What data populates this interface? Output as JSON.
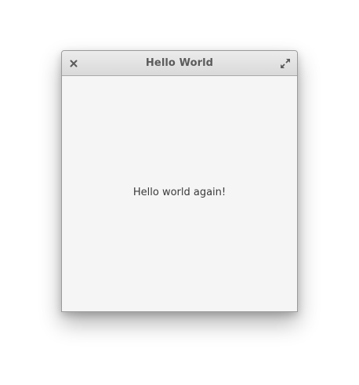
{
  "window": {
    "title": "Hello World",
    "close_icon": "close-icon",
    "maximize_icon": "maximize-icon"
  },
  "content": {
    "label": "Hello world again!"
  },
  "colors": {
    "titlebar_top": "#ececec",
    "titlebar_bottom": "#d9d9d9",
    "window_background": "#f5f5f5",
    "title_text": "#5b5b5b",
    "body_text": "#3a3a3a"
  }
}
